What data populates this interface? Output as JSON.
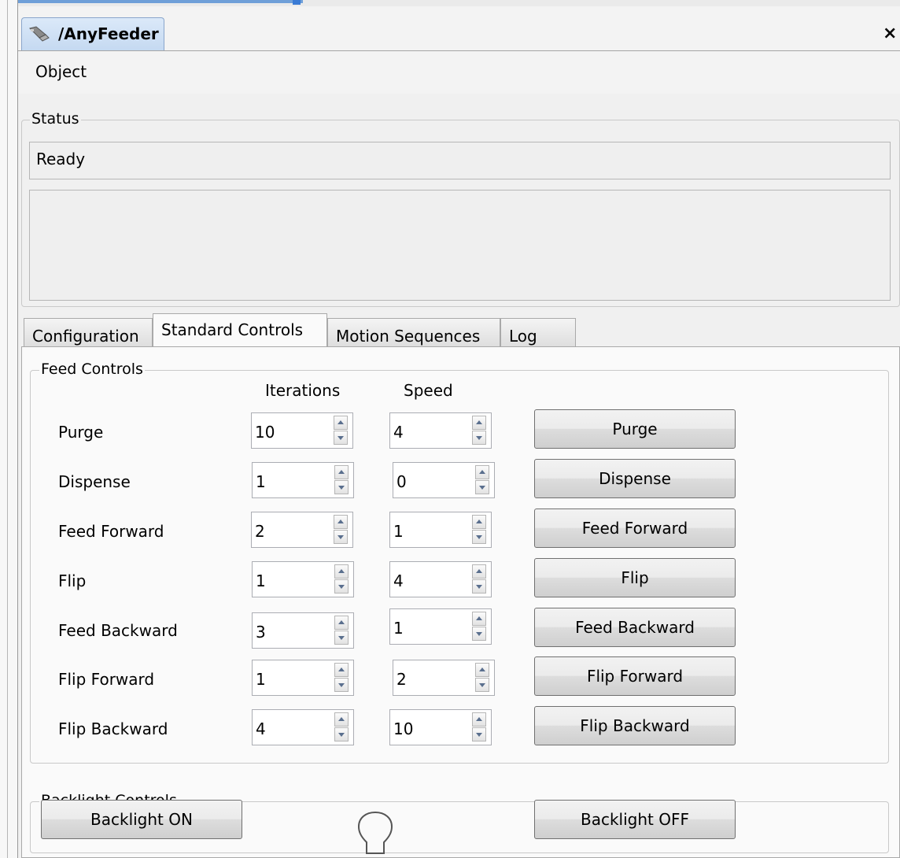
{
  "window": {
    "doc_tab_title": "/AnyFeeder",
    "close_symbol": "×"
  },
  "menu": {
    "object": "Object"
  },
  "status": {
    "legend": "Status",
    "state": "Ready",
    "details": ""
  },
  "tabs": [
    "Configuration",
    "Standard Controls",
    "Motion Sequences",
    "Log"
  ],
  "active_tab": "Standard Controls",
  "feed_controls": {
    "legend": "Feed Controls",
    "col_iterations": "Iterations",
    "col_speed": "Speed",
    "rows": [
      {
        "label": "Purge",
        "iterations": "10",
        "speed": "4",
        "button": "Purge"
      },
      {
        "label": "Dispense",
        "iterations": "1",
        "speed": "0",
        "button": "Dispense"
      },
      {
        "label": "Feed Forward",
        "iterations": "2",
        "speed": "1",
        "button": "Feed Forward"
      },
      {
        "label": "Flip",
        "iterations": "1",
        "speed": "4",
        "button": "Flip"
      },
      {
        "label": "Feed Backward",
        "iterations": "3",
        "speed": "1",
        "button": "Feed Backward"
      },
      {
        "label": "Flip Forward",
        "iterations": "1",
        "speed": "2",
        "button": "Flip Forward"
      },
      {
        "label": "Flip Backward",
        "iterations": "4",
        "speed": "10",
        "button": "Flip Backward"
      }
    ]
  },
  "backlight": {
    "legend": "Backlight Controls",
    "on_label": "Backlight ON",
    "off_label": "Backlight OFF",
    "indicator_icon": "lightbulb-icon"
  },
  "icons": {
    "app_icon": "feeder-icon",
    "close_icon": "close-icon",
    "spin_up": "arrow-up-icon",
    "spin_down": "arrow-down-icon"
  }
}
